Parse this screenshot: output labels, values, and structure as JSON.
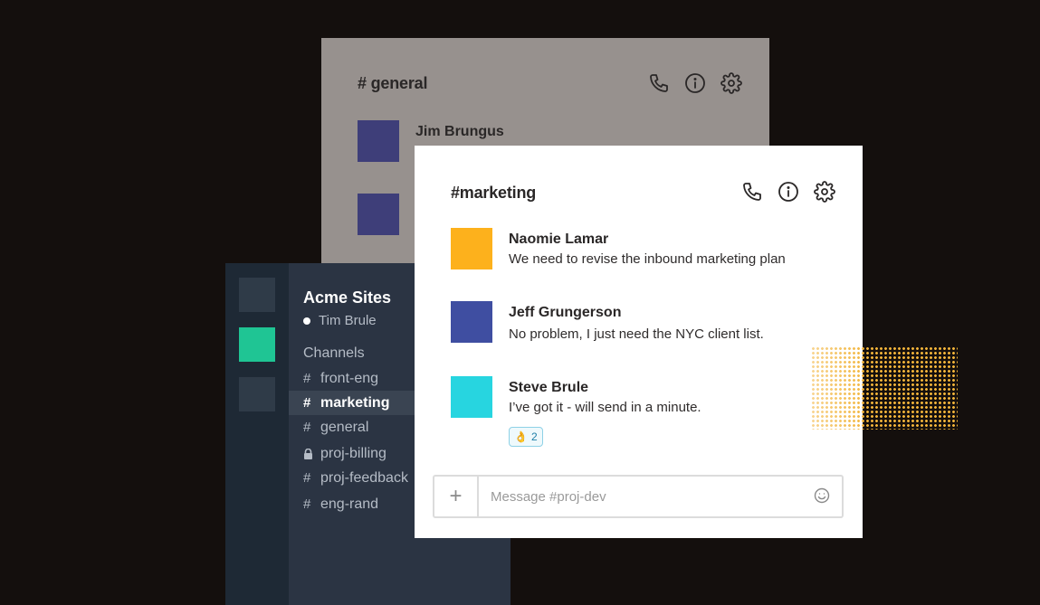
{
  "back_window": {
    "title": "# general",
    "author": "Jim Brungus",
    "avatar_color": "#3e3e79",
    "icons": [
      "phone-icon",
      "info-icon",
      "gear-icon"
    ]
  },
  "sidebar": {
    "workspace": "Acme Sites",
    "user": "Tim Brule",
    "channels_heading": "Channels",
    "accent_color": "#1fc594",
    "channels": [
      {
        "prefix": "#",
        "name": "front-eng",
        "active": false
      },
      {
        "prefix": "#",
        "name": "marketing",
        "active": true
      },
      {
        "prefix": "#",
        "name": "general",
        "active": false
      },
      {
        "prefix": "lock-icon",
        "name": "proj-billing",
        "active": false
      },
      {
        "prefix": "#",
        "name": "proj-feedback",
        "active": false
      },
      {
        "prefix": "#",
        "name": "eng-rand",
        "active": false
      }
    ]
  },
  "front_window": {
    "title": "#marketing",
    "icons": [
      "phone-icon",
      "info-icon",
      "gear-icon"
    ],
    "messages": [
      {
        "author": "Naomie Lamar",
        "text": "We need to revise the inbound marketing plan",
        "avatar_color": "#fdb11c"
      },
      {
        "author": "Jeff Grungerson",
        "text": "No problem, I just need the NYC client list.",
        "avatar_color": "#3f4ea1"
      },
      {
        "author": "Steve Brule",
        "text": "I’ve got it - will send in a minute.",
        "avatar_color": "#27d5e0"
      }
    ],
    "reaction": {
      "emoji": "👌",
      "count": "2"
    },
    "composer": {
      "plus_label": "+",
      "placeholder": "Message #proj-dev",
      "value": ""
    }
  }
}
